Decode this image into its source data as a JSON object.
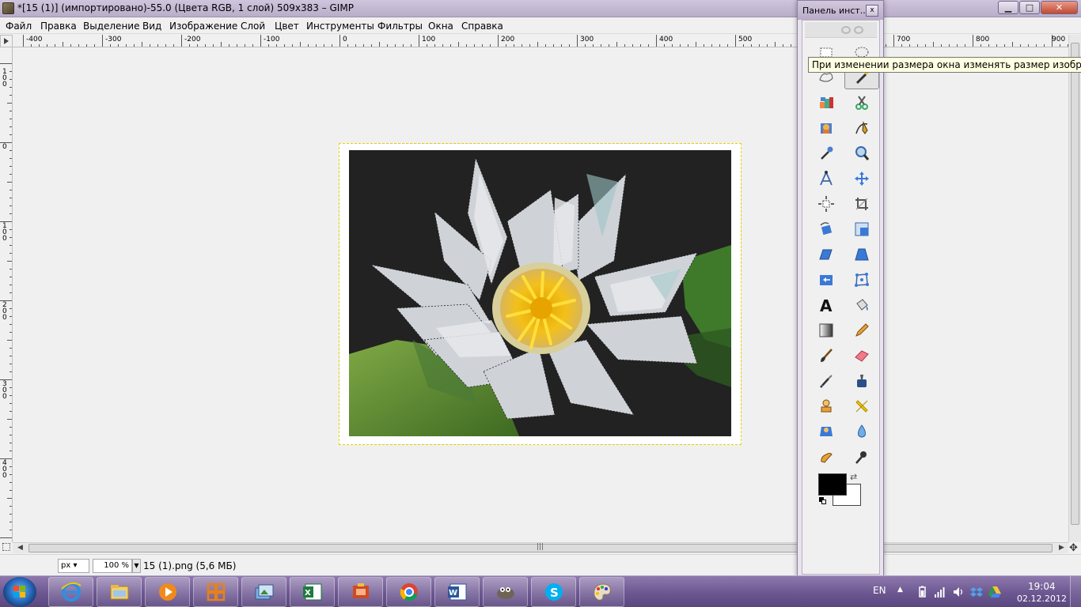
{
  "window": {
    "title": "*[15 (1)] (импортировано)-55.0 (Цвета RGB, 1 слой) 509x383 – GIMP",
    "minimize_label": "▁",
    "maximize_label": "□",
    "close_label": "✕"
  },
  "menu": [
    "Файл",
    "Правка",
    "Выделение",
    "Вид",
    "Изображение",
    "Слой",
    "Цвет",
    "Инструменты",
    "Фильтры",
    "Окна",
    "Справка"
  ],
  "rulers": {
    "horizontal": [
      "-400",
      "-300",
      "-200",
      "-100",
      "0",
      "100",
      "200",
      "300",
      "400",
      "500",
      "600",
      "700",
      "800",
      "900"
    ],
    "vertical": [
      "100",
      "0",
      "100",
      "200",
      "300",
      "400"
    ]
  },
  "statusbar": {
    "unit": "px",
    "zoom": "100 %",
    "text": "15 (1).png (5,6 МБ)"
  },
  "toolbox": {
    "title": "Панель инст...",
    "close_label": "x",
    "tooltip": "При изменении размера окна изменять размер изображения",
    "tools": [
      {
        "icon": "rect-select-icon"
      },
      {
        "icon": "ellipse-select-icon"
      },
      {
        "icon": "free-select-icon"
      },
      {
        "icon": "fuzzy-select-icon",
        "selected": true
      },
      {
        "icon": "select-by-color-icon"
      },
      {
        "icon": "scissors-select-icon"
      },
      {
        "icon": "foreground-select-icon"
      },
      {
        "icon": "paths-icon"
      },
      {
        "icon": "color-picker-icon"
      },
      {
        "icon": "zoom-icon"
      },
      {
        "icon": "measure-icon"
      },
      {
        "icon": "move-icon"
      },
      {
        "icon": "align-icon"
      },
      {
        "icon": "crop-icon"
      },
      {
        "icon": "rotate-icon"
      },
      {
        "icon": "scale-icon"
      },
      {
        "icon": "shear-icon"
      },
      {
        "icon": "perspective-icon"
      },
      {
        "icon": "flip-icon"
      },
      {
        "icon": "cage-transform-icon"
      },
      {
        "icon": "text-icon"
      },
      {
        "icon": "bucket-fill-icon"
      },
      {
        "icon": "blend-icon"
      },
      {
        "icon": "pencil-icon"
      },
      {
        "icon": "paintbrush-icon"
      },
      {
        "icon": "eraser-icon"
      },
      {
        "icon": "airbrush-icon"
      },
      {
        "icon": "ink-icon"
      },
      {
        "icon": "clone-icon"
      },
      {
        "icon": "heal-icon"
      },
      {
        "icon": "perspective-clone-icon"
      },
      {
        "icon": "blur-sharpen-icon"
      },
      {
        "icon": "smudge-icon"
      },
      {
        "icon": "dodge-burn-icon"
      }
    ],
    "foreground_color": "#000000",
    "background_color": "#ffffff",
    "text_tool_glyph": "A"
  },
  "taskbar": {
    "apps": [
      "internet-explorer-icon",
      "file-explorer-icon",
      "media-player-icon",
      "office-picture-icon",
      "photo-viewer-icon",
      "excel-icon",
      "powerpoint-icon",
      "chrome-icon",
      "word-icon",
      "gimp-icon",
      "skype-icon",
      "paint-icon"
    ],
    "language": "EN",
    "time": "19:04",
    "date": "02.12.2012"
  },
  "colors": {
    "titlebar": "#c4b9d3",
    "taskbar": "#6c5791",
    "selection_marching_ants": "#e8d200",
    "tooltip_bg": "#ffffe1"
  }
}
